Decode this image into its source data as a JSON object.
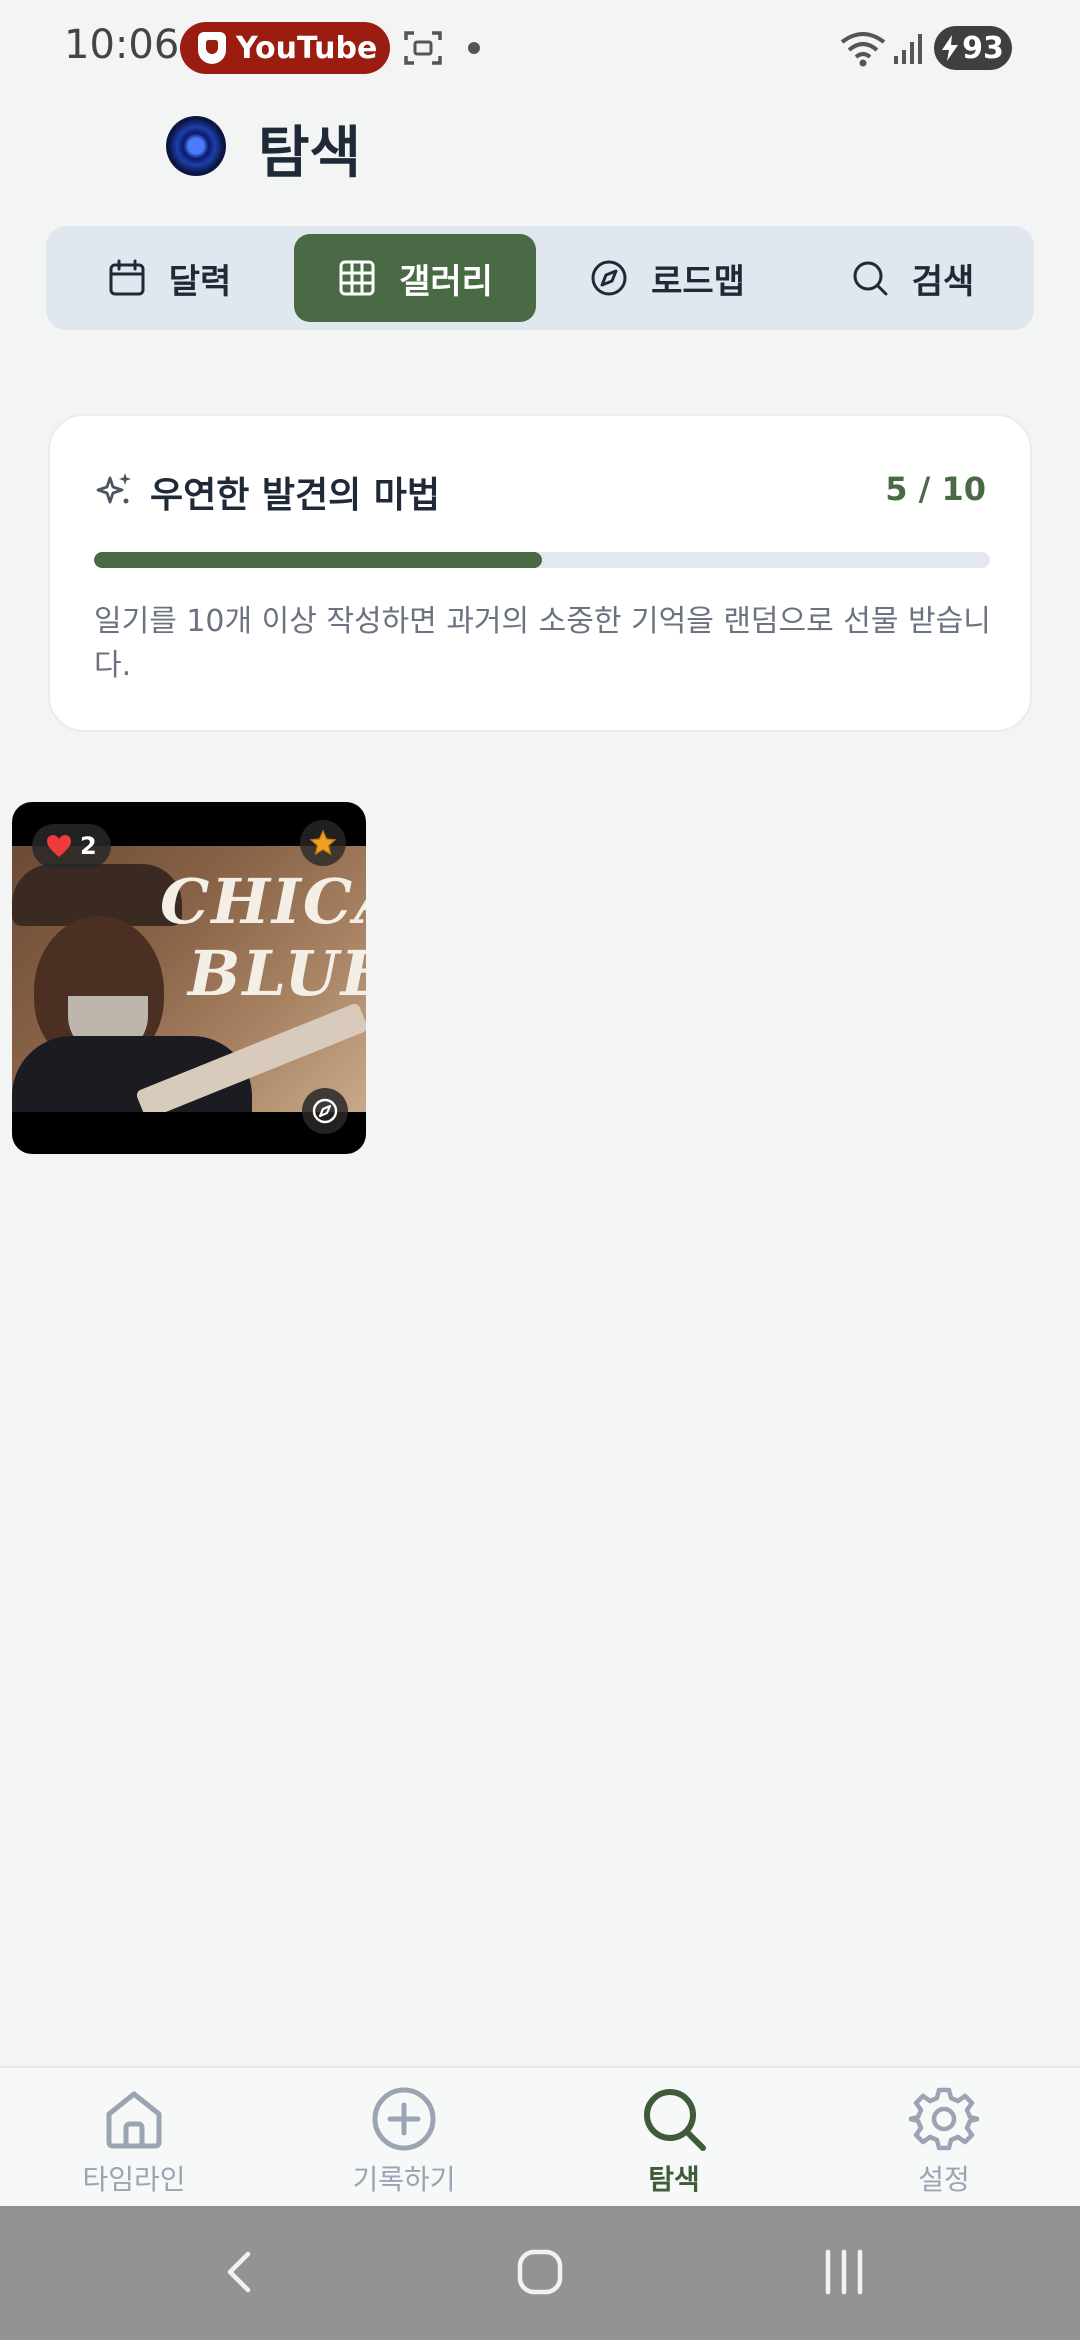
{
  "status_bar": {
    "time": "10:06",
    "notification_app": "YouTube",
    "battery": "93"
  },
  "header": {
    "title": "탐색"
  },
  "tabs": [
    {
      "label": "달력",
      "icon": "calendar-icon",
      "active": false
    },
    {
      "label": "갤러리",
      "icon": "grid-icon",
      "active": true
    },
    {
      "label": "로드맵",
      "icon": "compass-icon",
      "active": false
    },
    {
      "label": "검색",
      "icon": "search-icon",
      "active": false
    }
  ],
  "discovery_card": {
    "icon": "sparkles-icon",
    "title": "우연한 발견의 마법",
    "count": "5 / 10",
    "progress": 0.5,
    "description": "일기를 10개 이상 작성하면 과거의 소중한 기억을 랜덤으로 선물 받습니다."
  },
  "gallery": {
    "items": [
      {
        "likes": "2",
        "image_text": [
          "CHICAG",
          "BLUES"
        ],
        "favorite": true
      }
    ]
  },
  "bottom_nav": [
    {
      "label": "타임라인",
      "icon": "home-icon",
      "active": false
    },
    {
      "label": "기록하기",
      "icon": "plus-circle-icon",
      "active": false
    },
    {
      "label": "탐색",
      "icon": "search-icon",
      "active": true
    },
    {
      "label": "설정",
      "icon": "gear-icon",
      "active": false
    }
  ],
  "colors": {
    "accent": "#4a6a45",
    "background": "#f3f5f5",
    "tab_bar": "#e1e7ef"
  }
}
